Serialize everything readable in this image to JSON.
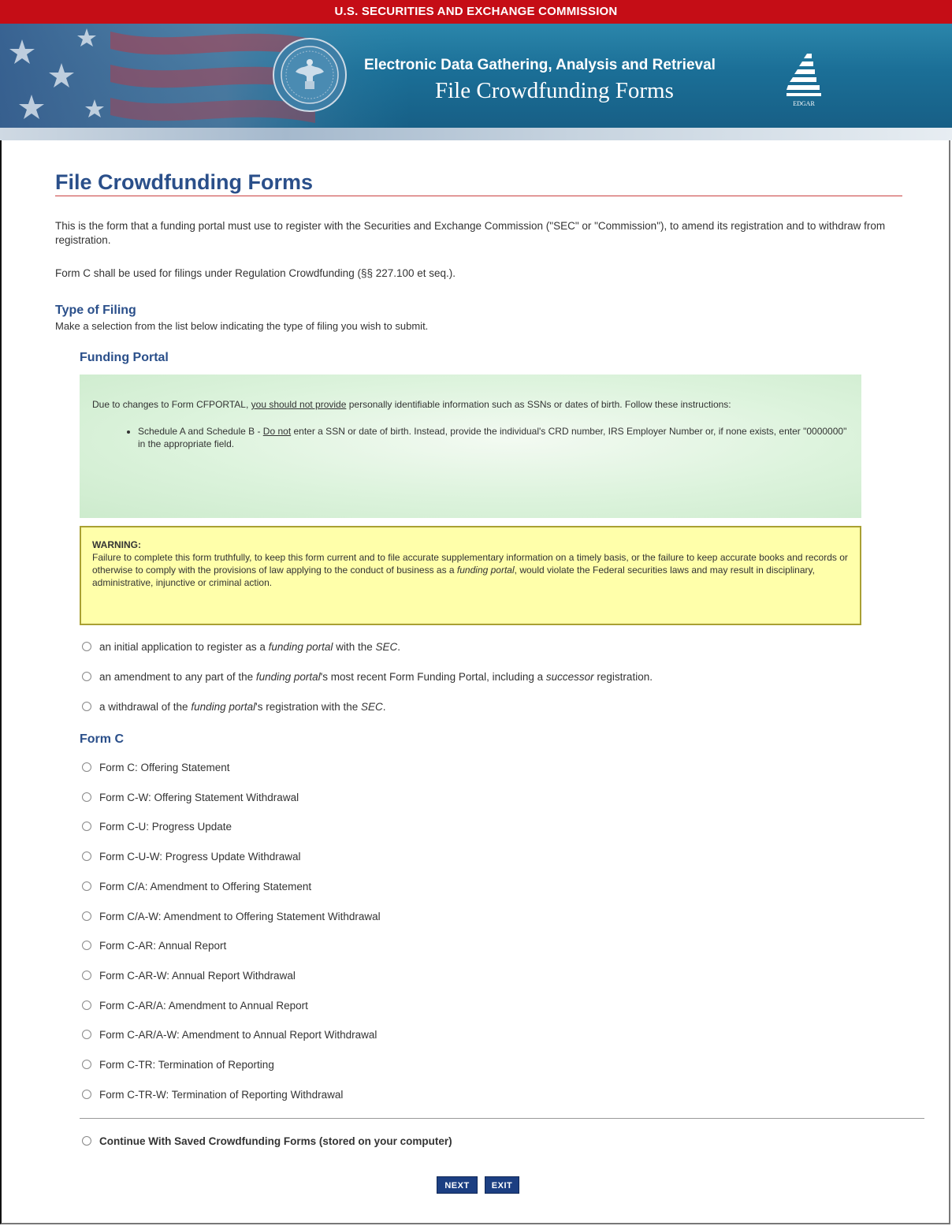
{
  "header": {
    "agency_bar": "U.S. SECURITIES AND EXCHANGE COMMISSION",
    "system_title": "Electronic Data Gathering, Analysis and Retrieval",
    "system_subtitle": "File Crowdfunding Forms",
    "edgar_logo_text": "EDGAR"
  },
  "page": {
    "title": "File Crowdfunding Forms",
    "intro": "This is the form that a funding portal must use to register with the Securities and Exchange Commission (\"SEC\" or \"Commission\"), to amend its registration and to withdraw from registration.",
    "form_c_note": "Form C shall be used for filings under Regulation Crowdfunding (§§ 227.100 et seq.).",
    "type_heading": "Type of Filing",
    "type_instruction": "Make a selection from the list below indicating the type of filing you wish to submit."
  },
  "funding_portal": {
    "heading": "Funding Portal",
    "notice": {
      "part1": "Due to changes to Form CFPORTAL, ",
      "part2_underlined": "you should not provide",
      "part3": " personally identifiable information such as SSNs or dates of birth. Follow these instructions:",
      "bullet_part1": "Schedule A and Schedule B - ",
      "bullet_part2_underlined": "Do not",
      "bullet_part3": " enter a SSN or date of birth. Instead, provide the individual's CRD number, IRS Employer Number or, if none exists, enter \"0000000\" in the appropriate field."
    },
    "warning": {
      "label": "WARNING:",
      "text_part1": "Failure to complete this form truthfully, to keep this form current and to file accurate supplementary information on a timely basis, or the failure to keep accurate books and records or otherwise to comply with the provisions of law applying to the conduct of business as a ",
      "text_italic": "funding portal",
      "text_part2": ", would violate the Federal securities laws and may result in disciplinary, administrative, injunctive or criminal action."
    },
    "options": {
      "initial": {
        "a": "an initial application to register as a ",
        "i1": "funding portal",
        "b": " with the ",
        "i2": "SEC",
        "c": "."
      },
      "amendment": {
        "a": "an amendment to any part of the ",
        "i1": "funding portal",
        "b": "'s most recent Form Funding Portal, including a ",
        "i2": "successor",
        "c": " registration."
      },
      "withdrawal": {
        "a": "a withdrawal of the ",
        "i1": "funding portal",
        "b": "'s registration with the ",
        "i2": "SEC",
        "c": "."
      }
    }
  },
  "form_c": {
    "heading": "Form C",
    "options": [
      "Form C: Offering Statement",
      "Form C-W: Offering Statement Withdrawal",
      "Form C-U: Progress Update",
      "Form C-U-W: Progress Update Withdrawal",
      "Form C/A: Amendment to Offering Statement",
      "Form C/A-W: Amendment to Offering Statement Withdrawal",
      "Form C-AR: Annual Report",
      "Form C-AR-W: Annual Report Withdrawal",
      "Form C-AR/A: Amendment to Annual Report",
      "Form C-AR/A-W: Amendment to Annual Report Withdrawal",
      "Form C-TR: Termination of Reporting",
      "Form C-TR-W: Termination of Reporting Withdrawal"
    ]
  },
  "continue_saved": "Continue With Saved Crowdfunding Forms (stored on your computer)",
  "buttons": {
    "next": "NEXT",
    "exit": "EXIT"
  },
  "colors": {
    "agency_bar": "#c50d16",
    "banner": "#1b6f97",
    "heading": "#2a4f8a",
    "notice_bg": "#dcf3dc",
    "warning_bg": "#ffffaa",
    "button": "#1c3f82"
  }
}
